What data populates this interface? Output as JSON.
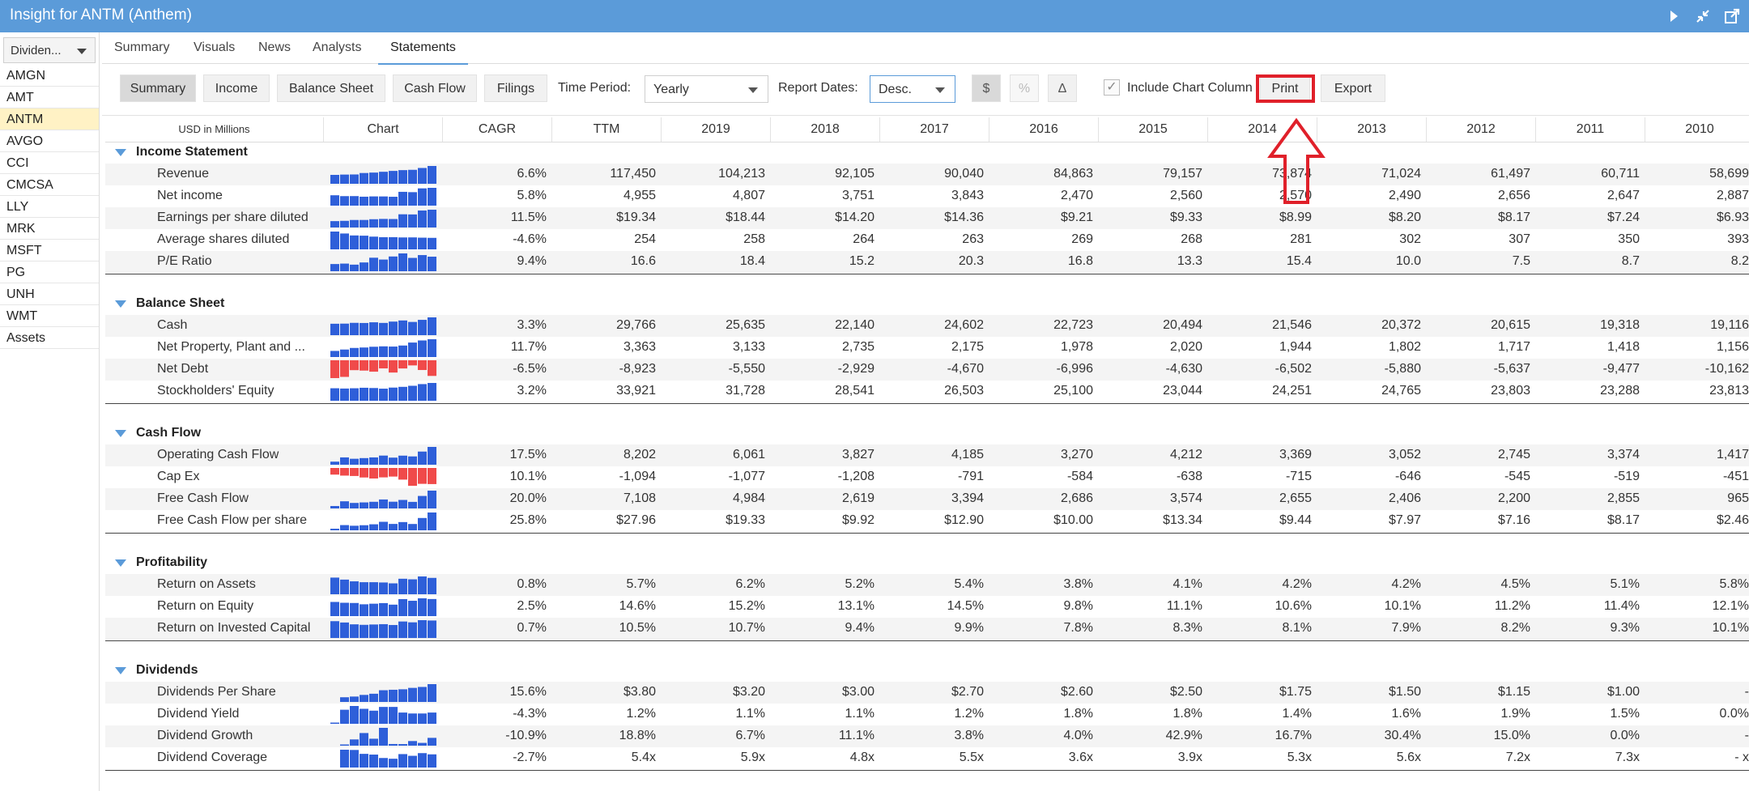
{
  "window": {
    "title": "Insight for ANTM (Anthem)"
  },
  "sidebar": {
    "watchlist_value": "Dividen...",
    "tickers": [
      "AMGN",
      "AMT",
      "ANTM",
      "AVGO",
      "CCI",
      "CMCSA",
      "LLY",
      "MRK",
      "MSFT",
      "PG",
      "UNH",
      "WMT",
      "Assets"
    ],
    "active_ticker": "ANTM"
  },
  "tabs": [
    "Summary",
    "Visuals",
    "News",
    "Analysts",
    "Statements"
  ],
  "active_tab": "Statements",
  "toolbar": {
    "buttons": [
      "Summary",
      "Income",
      "Balance Sheet",
      "Cash Flow",
      "Filings"
    ],
    "time_period_label": "Time Period:",
    "time_period_value": "Yearly",
    "report_dates_label": "Report Dates:",
    "report_dates_value": "Desc.",
    "dollar": "$",
    "percent": "%",
    "delta": "Δ",
    "include_chart_label": "Include Chart Column",
    "print_label": "Print",
    "export_label": "Export"
  },
  "colors": {
    "accent": "#5b9bd9",
    "bar_pos": "#2e5fd9",
    "bar_neg": "#f04a4a",
    "highlight": "#e0202a"
  },
  "table": {
    "units_header": "USD in Millions",
    "chart_header": "Chart",
    "cagr_header": "CAGR",
    "columns": [
      "TTM",
      "2019",
      "2018",
      "2017",
      "2016",
      "2015",
      "2014",
      "2013",
      "2012",
      "2011",
      "2010"
    ],
    "sections": [
      {
        "title": "Income Statement",
        "rows": [
          {
            "label": "Revenue",
            "cagr": "6.6%",
            "values": [
              "117,450",
              "104,213",
              "92,105",
              "90,040",
              "84,863",
              "79,157",
              "73,874",
              "71,024",
              "61,497",
              "60,711",
              "58,699"
            ]
          },
          {
            "label": "Net income",
            "cagr": "5.8%",
            "values": [
              "4,955",
              "4,807",
              "3,751",
              "3,843",
              "2,470",
              "2,560",
              "2,570",
              "2,490",
              "2,656",
              "2,647",
              "2,887"
            ]
          },
          {
            "label": "Earnings per share diluted",
            "cagr": "11.5%",
            "values": [
              "$19.34",
              "$18.44",
              "$14.20",
              "$14.36",
              "$9.21",
              "$9.33",
              "$8.99",
              "$8.20",
              "$8.17",
              "$7.24",
              "$6.93"
            ]
          },
          {
            "label": "Average shares diluted",
            "cagr": "-4.6%",
            "values": [
              "254",
              "258",
              "264",
              "263",
              "269",
              "268",
              "281",
              "302",
              "307",
              "350",
              "393"
            ]
          },
          {
            "label": "P/E Ratio",
            "cagr": "9.4%",
            "values": [
              "16.6",
              "18.4",
              "15.2",
              "20.3",
              "16.8",
              "13.3",
              "15.4",
              "10.0",
              "7.5",
              "8.7",
              "8.2"
            ]
          }
        ]
      },
      {
        "title": "Balance Sheet",
        "rows": [
          {
            "label": "Cash",
            "cagr": "3.3%",
            "values": [
              "29,766",
              "25,635",
              "22,140",
              "24,602",
              "22,723",
              "20,494",
              "21,546",
              "20,372",
              "20,615",
              "19,318",
              "19,116"
            ]
          },
          {
            "label": "Net Property, Plant and ...",
            "cagr": "11.7%",
            "values": [
              "3,363",
              "3,133",
              "2,735",
              "2,175",
              "1,978",
              "2,020",
              "1,944",
              "1,802",
              "1,717",
              "1,418",
              "1,156"
            ]
          },
          {
            "label": "Net Debt",
            "cagr": "-6.5%",
            "values": [
              "-8,923",
              "-5,550",
              "-2,929",
              "-4,670",
              "-6,996",
              "-4,630",
              "-6,502",
              "-5,880",
              "-5,637",
              "-9,477",
              "-10,162"
            ]
          },
          {
            "label": "Stockholders' Equity",
            "cagr": "3.2%",
            "values": [
              "33,921",
              "31,728",
              "28,541",
              "26,503",
              "25,100",
              "23,044",
              "24,251",
              "24,765",
              "23,803",
              "23,288",
              "23,813"
            ]
          }
        ]
      },
      {
        "title": "Cash Flow",
        "rows": [
          {
            "label": "Operating Cash Flow",
            "cagr": "17.5%",
            "values": [
              "8,202",
              "6,061",
              "3,827",
              "4,185",
              "3,270",
              "4,212",
              "3,369",
              "3,052",
              "2,745",
              "3,374",
              "1,417"
            ]
          },
          {
            "label": "Cap Ex",
            "cagr": "10.1%",
            "values": [
              "-1,094",
              "-1,077",
              "-1,208",
              "-791",
              "-584",
              "-638",
              "-715",
              "-646",
              "-545",
              "-519",
              "-451"
            ]
          },
          {
            "label": "Free Cash Flow",
            "cagr": "20.0%",
            "values": [
              "7,108",
              "4,984",
              "2,619",
              "3,394",
              "2,686",
              "3,574",
              "2,655",
              "2,406",
              "2,200",
              "2,855",
              "965"
            ]
          },
          {
            "label": "Free Cash Flow per share",
            "cagr": "25.8%",
            "values": [
              "$27.96",
              "$19.33",
              "$9.92",
              "$12.90",
              "$10.00",
              "$13.34",
              "$9.44",
              "$7.97",
              "$7.16",
              "$8.17",
              "$2.46"
            ]
          }
        ]
      },
      {
        "title": "Profitability",
        "rows": [
          {
            "label": "Return on Assets",
            "cagr": "0.8%",
            "values": [
              "5.7%",
              "6.2%",
              "5.2%",
              "5.4%",
              "3.8%",
              "4.1%",
              "4.2%",
              "4.2%",
              "4.5%",
              "5.1%",
              "5.8%"
            ]
          },
          {
            "label": "Return on Equity",
            "cagr": "2.5%",
            "values": [
              "14.6%",
              "15.2%",
              "13.1%",
              "14.5%",
              "9.8%",
              "11.1%",
              "10.6%",
              "10.1%",
              "11.2%",
              "11.4%",
              "12.1%"
            ]
          },
          {
            "label": "Return on Invested Capital",
            "cagr": "0.7%",
            "values": [
              "10.5%",
              "10.7%",
              "9.4%",
              "9.9%",
              "7.8%",
              "8.3%",
              "8.1%",
              "7.9%",
              "8.2%",
              "9.3%",
              "10.1%"
            ]
          }
        ]
      },
      {
        "title": "Dividends",
        "rows": [
          {
            "label": "Dividends Per Share",
            "cagr": "15.6%",
            "values": [
              "$3.80",
              "$3.20",
              "$3.00",
              "$2.70",
              "$2.60",
              "$2.50",
              "$1.75",
              "$1.50",
              "$1.15",
              "$1.00",
              "-"
            ]
          },
          {
            "label": "Dividend Yield",
            "cagr": "-4.3%",
            "values": [
              "1.2%",
              "1.1%",
              "1.1%",
              "1.2%",
              "1.8%",
              "1.8%",
              "1.4%",
              "1.6%",
              "1.9%",
              "1.5%",
              "0.0%"
            ]
          },
          {
            "label": "Dividend Growth",
            "cagr": "-10.9%",
            "values": [
              "18.8%",
              "6.7%",
              "11.1%",
              "3.8%",
              "4.0%",
              "42.9%",
              "16.7%",
              "30.4%",
              "15.0%",
              "0.0%",
              "-"
            ]
          },
          {
            "label": "Dividend Coverage",
            "cagr": "-2.7%",
            "values": [
              "5.4x",
              "5.9x",
              "4.8x",
              "5.5x",
              "3.6x",
              "3.9x",
              "5.3x",
              "5.6x",
              "7.2x",
              "7.3x",
              "- x"
            ]
          }
        ]
      }
    ]
  }
}
